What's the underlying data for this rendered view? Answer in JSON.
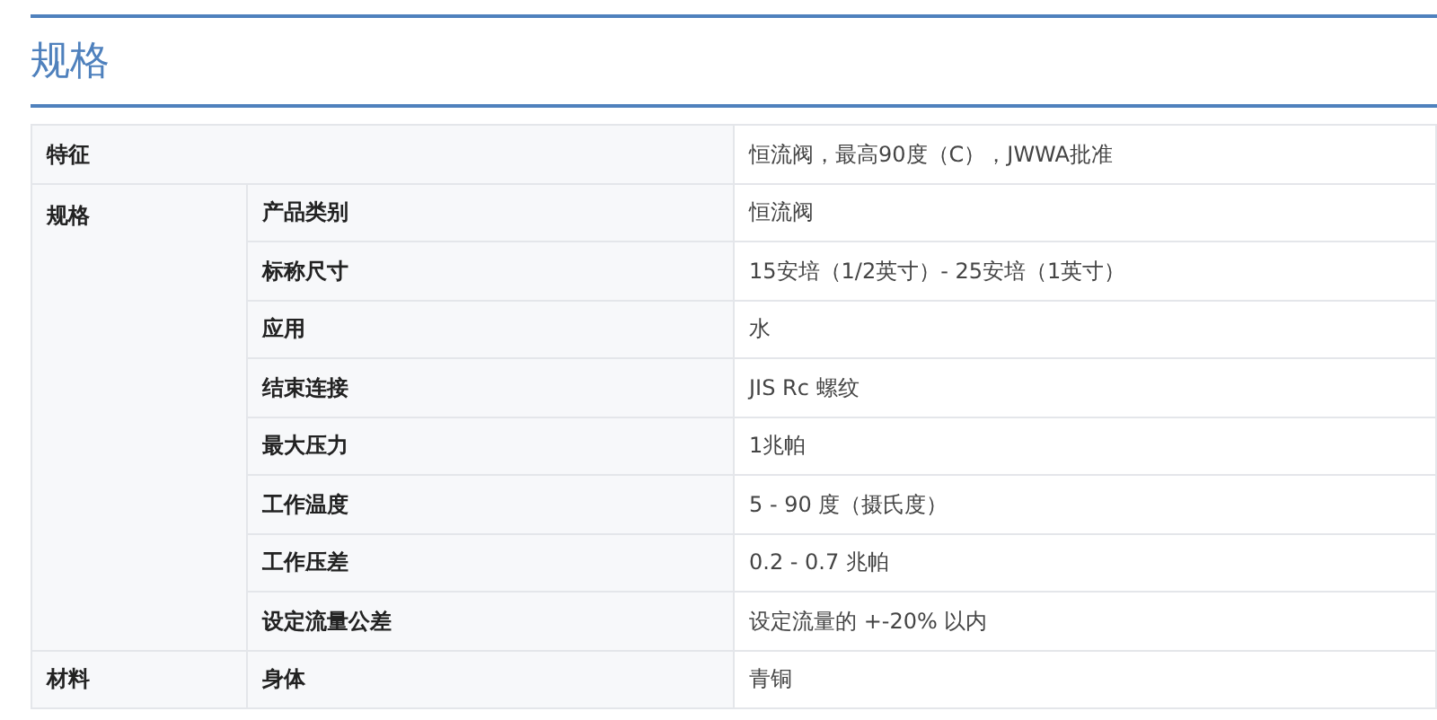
{
  "title": "规格",
  "groups": [
    {
      "label": "特征",
      "items": [
        {
          "value": "恒流阀，最高90度（C），JWWA批准"
        }
      ]
    },
    {
      "label": "规格",
      "items": [
        {
          "name": "产品类别",
          "value": "恒流阀"
        },
        {
          "name": "标称尺寸",
          "value": "15安培（1/2英寸）- 25安培（1英寸）"
        },
        {
          "name": "应用",
          "value": "水"
        },
        {
          "name": "结束连接",
          "value": "JIS Rc 螺纹"
        },
        {
          "name": "最大压力",
          "value": "1兆帕"
        },
        {
          "name": "工作温度",
          "value": "5 - 90 度（摄氏度）"
        },
        {
          "name": "工作压差",
          "value": "0.2 - 0.7 兆帕"
        },
        {
          "name": "设定流量公差",
          "value": "设定流量的 +-20% 以内"
        }
      ]
    },
    {
      "label": "材料",
      "items": [
        {
          "name": "身体",
          "value": "青铜"
        }
      ]
    }
  ]
}
